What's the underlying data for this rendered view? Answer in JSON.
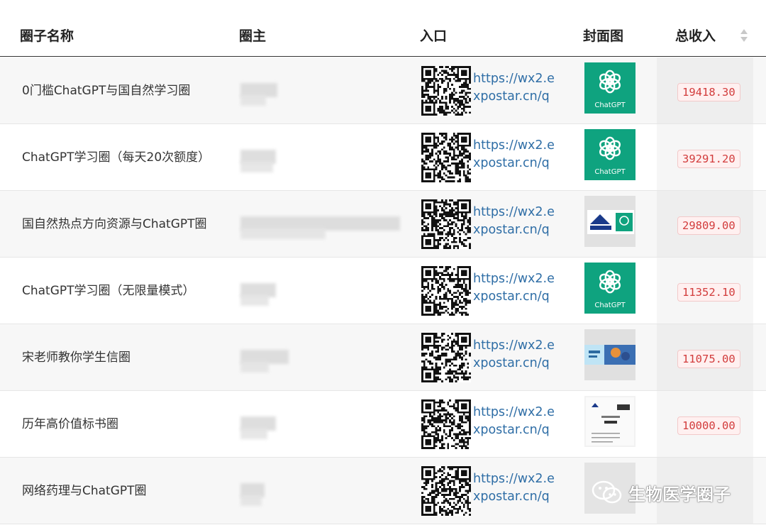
{
  "table": {
    "headers": {
      "name": "圈子名称",
      "owner": "圈主",
      "entry": "入口",
      "cover": "封面图",
      "income": "总收入"
    },
    "sort_icon": "sort-arrows-icon",
    "rows": [
      {
        "name": "0门槛ChatGPT与国自然学习圈",
        "link": "https://wx2.expostar.cn/q",
        "cover": "chatgpt-logo",
        "cover_text": "ChatGPT",
        "income": "19418.30"
      },
      {
        "name": "ChatGPT学习圈（每天20次额度）",
        "link": "https://wx2.expostar.cn/q",
        "cover": "chatgpt-logo",
        "cover_text": "ChatGPT",
        "income": "39291.20"
      },
      {
        "name": "国自然热点方向资源与ChatGPT圈",
        "link": "https://wx2.expostar.cn/q",
        "cover": "nsfc-chatgpt-image",
        "cover_text": "",
        "income": "29809.00"
      },
      {
        "name": "ChatGPT学习圈（无限量模式）",
        "link": "https://wx2.expostar.cn/q",
        "cover": "chatgpt-logo",
        "cover_text": "ChatGPT",
        "income": "11352.10"
      },
      {
        "name": "宋老师教你学生信圈",
        "link": "https://wx2.expostar.cn/q",
        "cover": "bio-banner-image",
        "cover_text": "",
        "income": "11075.00"
      },
      {
        "name": "历年高价值标书圈",
        "link": "https://wx2.expostar.cn/q",
        "cover": "document-image",
        "cover_text": "",
        "income": "10000.00"
      },
      {
        "name": "网络药理与ChatGPT圈",
        "link": "https://wx2.expostar.cn/q",
        "cover": "placeholder-image",
        "cover_text": "",
        "income": ""
      }
    ]
  },
  "watermark": {
    "text": "生物医学圈子",
    "icon": "wechat-icon"
  },
  "colors": {
    "link": "#2f6ea6",
    "income_text": "#d23c3c",
    "income_bg": "#fff0f0",
    "chatgpt_green": "#0fa37f",
    "row_alt": "#f7f7f7"
  }
}
